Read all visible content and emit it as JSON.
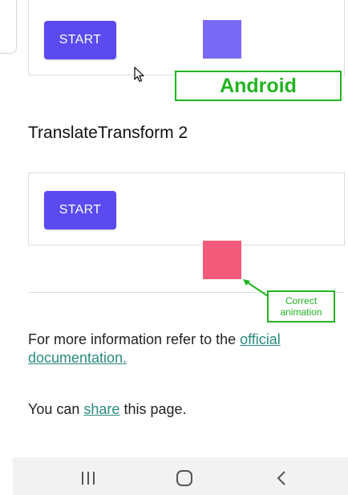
{
  "top_demo": {
    "start_label": "START"
  },
  "annotation": {
    "platform_label": "Android",
    "callout_line1": "Correct",
    "callout_line2": "animation",
    "accent_color": "#22b422"
  },
  "section": {
    "title": "TranslateTransform 2"
  },
  "mid_demo": {
    "start_label": "START"
  },
  "info": {
    "prefix": "For more information refer to the ",
    "link_text": "official documentation."
  },
  "share": {
    "prefix": "You can ",
    "link_text": "share",
    "suffix": " this page."
  },
  "colors": {
    "button": "#5a4af0",
    "square_top": "#7a6af5",
    "square_translated": "#f45a7c",
    "link": "#2a8a7e"
  },
  "nav": {
    "icons": [
      "recent-apps-icon",
      "home-icon",
      "back-icon"
    ]
  }
}
